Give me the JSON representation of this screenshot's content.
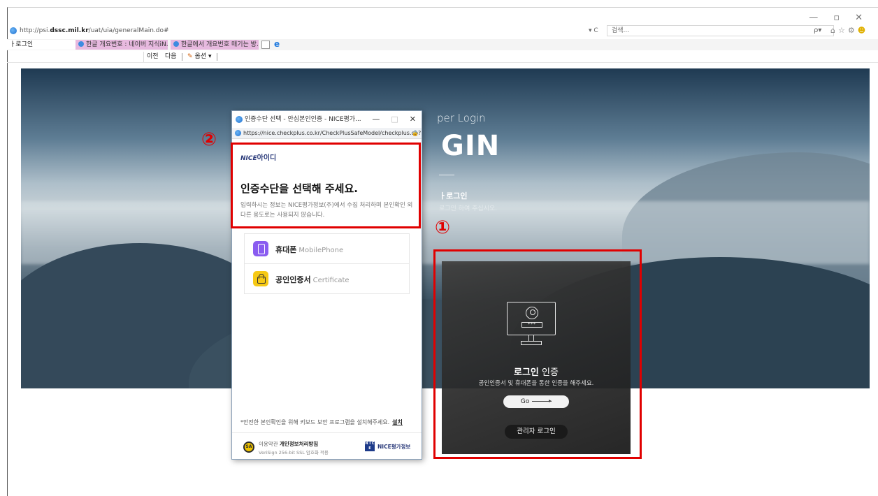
{
  "browser": {
    "url_prefix": "http://psi.",
    "url_host": "dssc.mil.kr",
    "url_path": "/uat/uia/generalMain.do#",
    "refresh_label": "▾ C",
    "search_placeholder": "검색...",
    "search_dropdown": "ρ▾",
    "window_controls": {
      "minimize": "—",
      "maximize": "▫",
      "close": "✕"
    },
    "toolbar_icons": {
      "home": "⌂",
      "favorites": "☆",
      "settings": "⚙",
      "feedback": "☻"
    }
  },
  "tabs": [
    {
      "label": "ㅏ로그인",
      "close": "×",
      "active": true
    },
    {
      "label": "한글 개요번호 : 네이버 지식iN...",
      "active": false
    },
    {
      "label": "한글에서 개요번호 매기는 방...",
      "active": false
    }
  ],
  "find_bar": {
    "prev": "이전",
    "next": "다음",
    "options": "옵션 ▾"
  },
  "hero": {
    "subtitle": "per Login",
    "title": "GIN",
    "heading": "ㅏ로그인",
    "desc": "로그인 하여 주십시오."
  },
  "login_card": {
    "pw_mask": "***",
    "title_bold": "로그인",
    "title_rest": " 인증",
    "desc": "공인인증서 및 휴대폰을 통한 인증을 해주세요.",
    "go_label": "Go",
    "admin_label": "관리자 로그인"
  },
  "badges": {
    "one": "①",
    "two": "②"
  },
  "popup": {
    "window_title": "인증수단 선택 - 안심본인인증 - NICE평가...",
    "url": "https://nice.checkplus.co.kr/CheckPlusSafeModel/checkplus.cb?m=",
    "lock": "🔒",
    "controls": {
      "minimize": "—",
      "maximize": "□",
      "close": "✕"
    },
    "logo_nice": "NICE",
    "logo_id": "아이디",
    "title": "인증수단을 선택해 주세요.",
    "desc": "입력하시는 정보는 NICE평가정보(주)에서 수집 처리하며 본인확인 외 다른 용도로는 사용되지 않습니다.",
    "auth_methods": [
      {
        "label": "휴대폰",
        "en": "MobilePhone",
        "icon": "phone-icon"
      },
      {
        "label": "공인인증서",
        "en": "Certificate",
        "icon": "lock-icon"
      }
    ],
    "note": "*안전한 본인확인을 위해 키보드 보안 프로그램을 설치해주세요.",
    "install_link": "설치",
    "sa_badge": "SA",
    "privacy_prefix": "이용약관 ",
    "privacy_bold": "개인정보처리방침",
    "privacy_sub": "VeriSign 256-bit SSL 암호화 적용",
    "footer_logo_sq": "N I C E",
    "footer_logo": "NICE평가정보"
  }
}
